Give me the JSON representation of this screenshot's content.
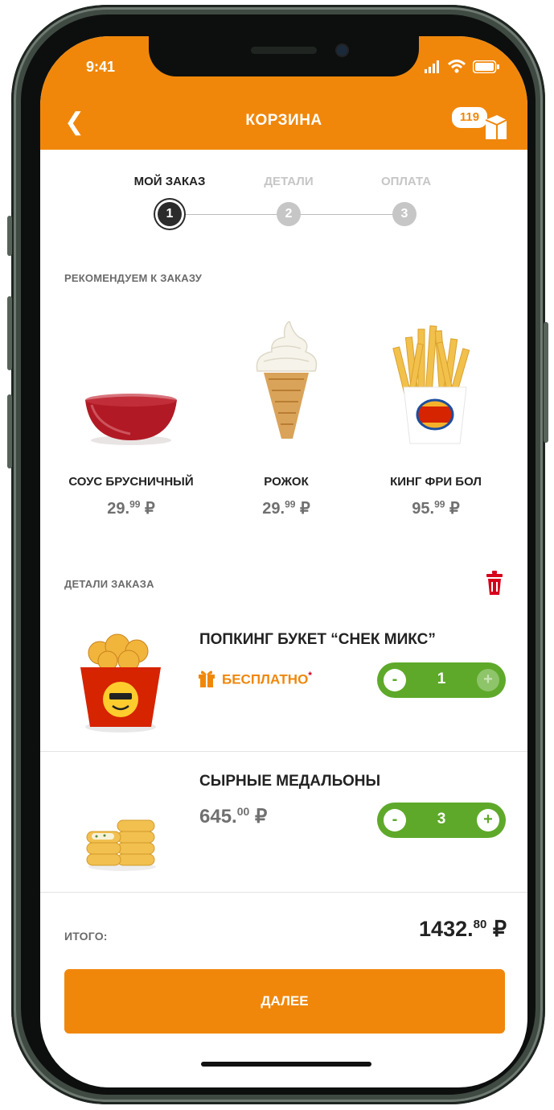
{
  "status_bar": {
    "time": "9:41"
  },
  "header": {
    "title": "КОРЗИНА",
    "points": "119"
  },
  "steps": [
    {
      "label": "МОЙ ЗАКАЗ",
      "number": "1"
    },
    {
      "label": "ДЕТАЛИ",
      "number": "2"
    },
    {
      "label": "ОПЛАТА",
      "number": "3"
    }
  ],
  "recommend": {
    "heading": "РЕКОМЕНДУЕМ К ЗАКАЗУ",
    "items": [
      {
        "name": "СОУС БРУСНИЧНЫЙ",
        "price_main": "29.",
        "price_cents": "99",
        "currency": "₽"
      },
      {
        "name": "РОЖОК",
        "price_main": "29.",
        "price_cents": "99",
        "currency": "₽"
      },
      {
        "name": "КИНГ ФРИ БОЛ",
        "price_main": "95.",
        "price_cents": "99",
        "currency": "₽"
      }
    ]
  },
  "order": {
    "heading": "ДЕТАЛИ ЗАКАЗА",
    "items": [
      {
        "name": "ПОПКИНГ БУКЕТ “СНЕК МИКС”",
        "free_label": "БЕСПЛАТНО",
        "asterisk": "*",
        "qty": "1",
        "minus": "-",
        "plus": "+"
      },
      {
        "name": "СЫРНЫЕ МЕДАЛЬОНЫ",
        "price_main": "645.",
        "price_cents": "00",
        "currency": "₽",
        "qty": "3",
        "minus": "-",
        "plus": "+"
      }
    ]
  },
  "total": {
    "label": "ИТОГО:",
    "value_main": "1432.",
    "value_cents": "80",
    "currency": "₽"
  },
  "cta": {
    "label": "ДАЛЕЕ"
  },
  "colors": {
    "accent": "#f0870b",
    "green": "#5ea92a",
    "delete": "#d6001c"
  }
}
